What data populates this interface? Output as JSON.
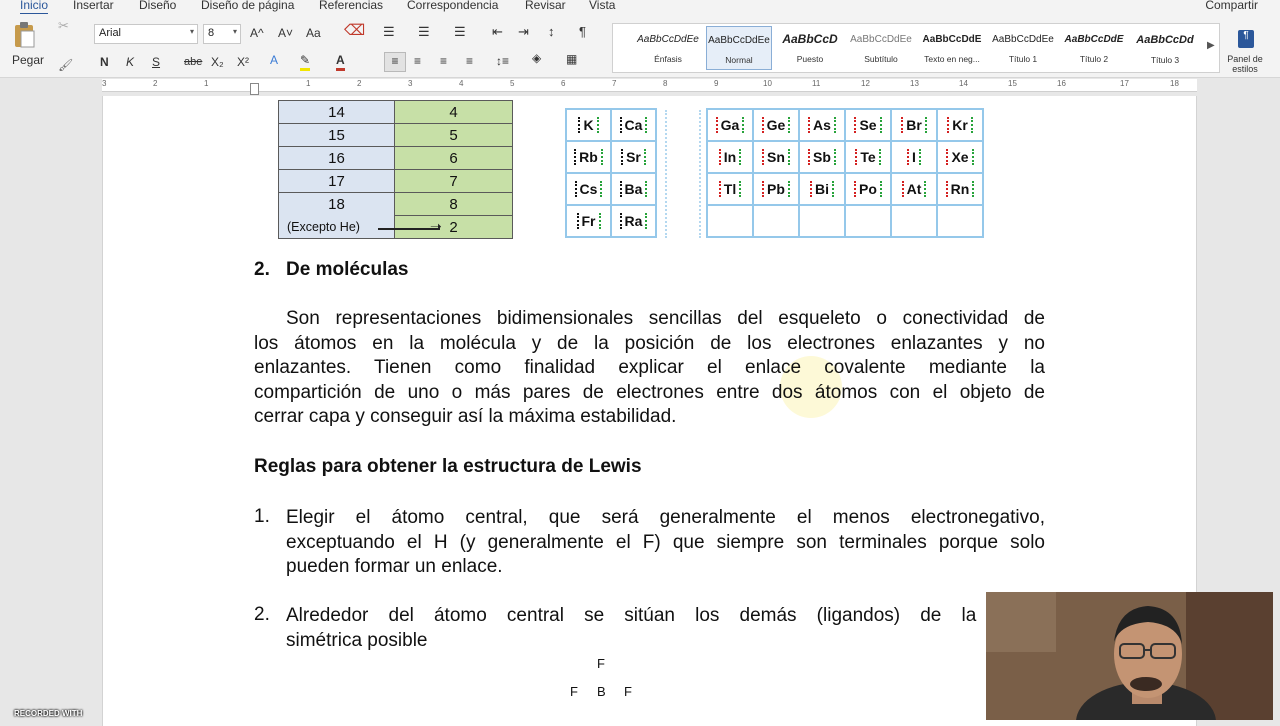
{
  "tabs": [
    "Inicio",
    "Insertar",
    "Diseño",
    "Diseño de página",
    "Referencias",
    "Correspondencia",
    "Revisar",
    "Vista"
  ],
  "share": "Compartir",
  "ribbon": {
    "paste": "Pegar",
    "font": "Arial",
    "size": "8",
    "format_buttons": [
      "N",
      "K",
      "S",
      "abe",
      "X₂",
      "X²"
    ],
    "styles": [
      {
        "preview": "AaBbCcDdEe",
        "name": "Énfasis"
      },
      {
        "preview": "AaBbCcDdEe",
        "name": "Normal"
      },
      {
        "preview": "AaBbCcD",
        "name": "Puesto"
      },
      {
        "preview": "AaBbCcDdEe",
        "name": "Subtítulo"
      },
      {
        "preview": "AaBbCcDdE",
        "name": "Texto en neg..."
      },
      {
        "preview": "AaBbCcDdEe",
        "name": "Título 1"
      },
      {
        "preview": "AaBbCcDdE",
        "name": "Título 2"
      },
      {
        "preview": "AaBbCcDd",
        "name": "Título 3"
      }
    ],
    "styles_pane": "Panel de estilos"
  },
  "ruler": [
    "3",
    "2",
    "1",
    "1",
    "2",
    "3",
    "4",
    "5",
    "6",
    "7",
    "8",
    "9",
    "10",
    "11",
    "12",
    "13",
    "14",
    "15",
    "16",
    "17",
    "18"
  ],
  "group_table": [
    [
      "14",
      "4"
    ],
    [
      "15",
      "5"
    ],
    [
      "16",
      "6"
    ],
    [
      "17",
      "7"
    ],
    [
      "18",
      "8"
    ],
    [
      "(Excepto He)",
      "2"
    ]
  ],
  "periodic": {
    "left": [
      [
        "K",
        "Ca"
      ],
      [
        "Rb",
        "Sr"
      ],
      [
        "Cs",
        "Ba"
      ],
      [
        "Fr",
        "Ra"
      ]
    ],
    "right": [
      [
        "Ga",
        "Ge",
        "As",
        "Se",
        "Br",
        "Kr"
      ],
      [
        "In",
        "Sn",
        "Sb",
        "Te",
        "I",
        "Xe"
      ],
      [
        "Tl",
        "Pb",
        "Bi",
        "Po",
        "At",
        "Rn"
      ],
      [
        "",
        "",
        "",
        "",
        "",
        ""
      ]
    ]
  },
  "section2": {
    "num": "2.",
    "title": "De moléculas"
  },
  "para1": [
    "Son representaciones bidimensionales sencillas del esqueleto o conectividad de",
    "los átomos en la molécula y de la posición de los electrones enlazantes y no",
    "enlazantes. Tienen como finalidad explicar el enlace covalente mediante la",
    "compartición de uno o más pares de electrones entre dos átomos con el objeto de",
    "cerrar capa y conseguir así la máxima estabilidad."
  ],
  "rules_title": "Reglas para obtener la estructura de Lewis",
  "rule1": {
    "num": "1.",
    "lines": [
      "Elegir el átomo central, que será generalmente el menos electronegativo,",
      "exceptuando el H (y generalmente el F) que siempre son terminales porque solo",
      "pueden formar un enlace."
    ]
  },
  "rule2": {
    "num": "2.",
    "lines": [
      "Alrededor del átomo central se sitúan los demás (ligandos) de la forma",
      "simétrica posible"
    ]
  },
  "bf3": {
    "top": "F",
    "left": "F",
    "center": "B",
    "right": "F"
  },
  "recorded": "RECORDED WITH"
}
